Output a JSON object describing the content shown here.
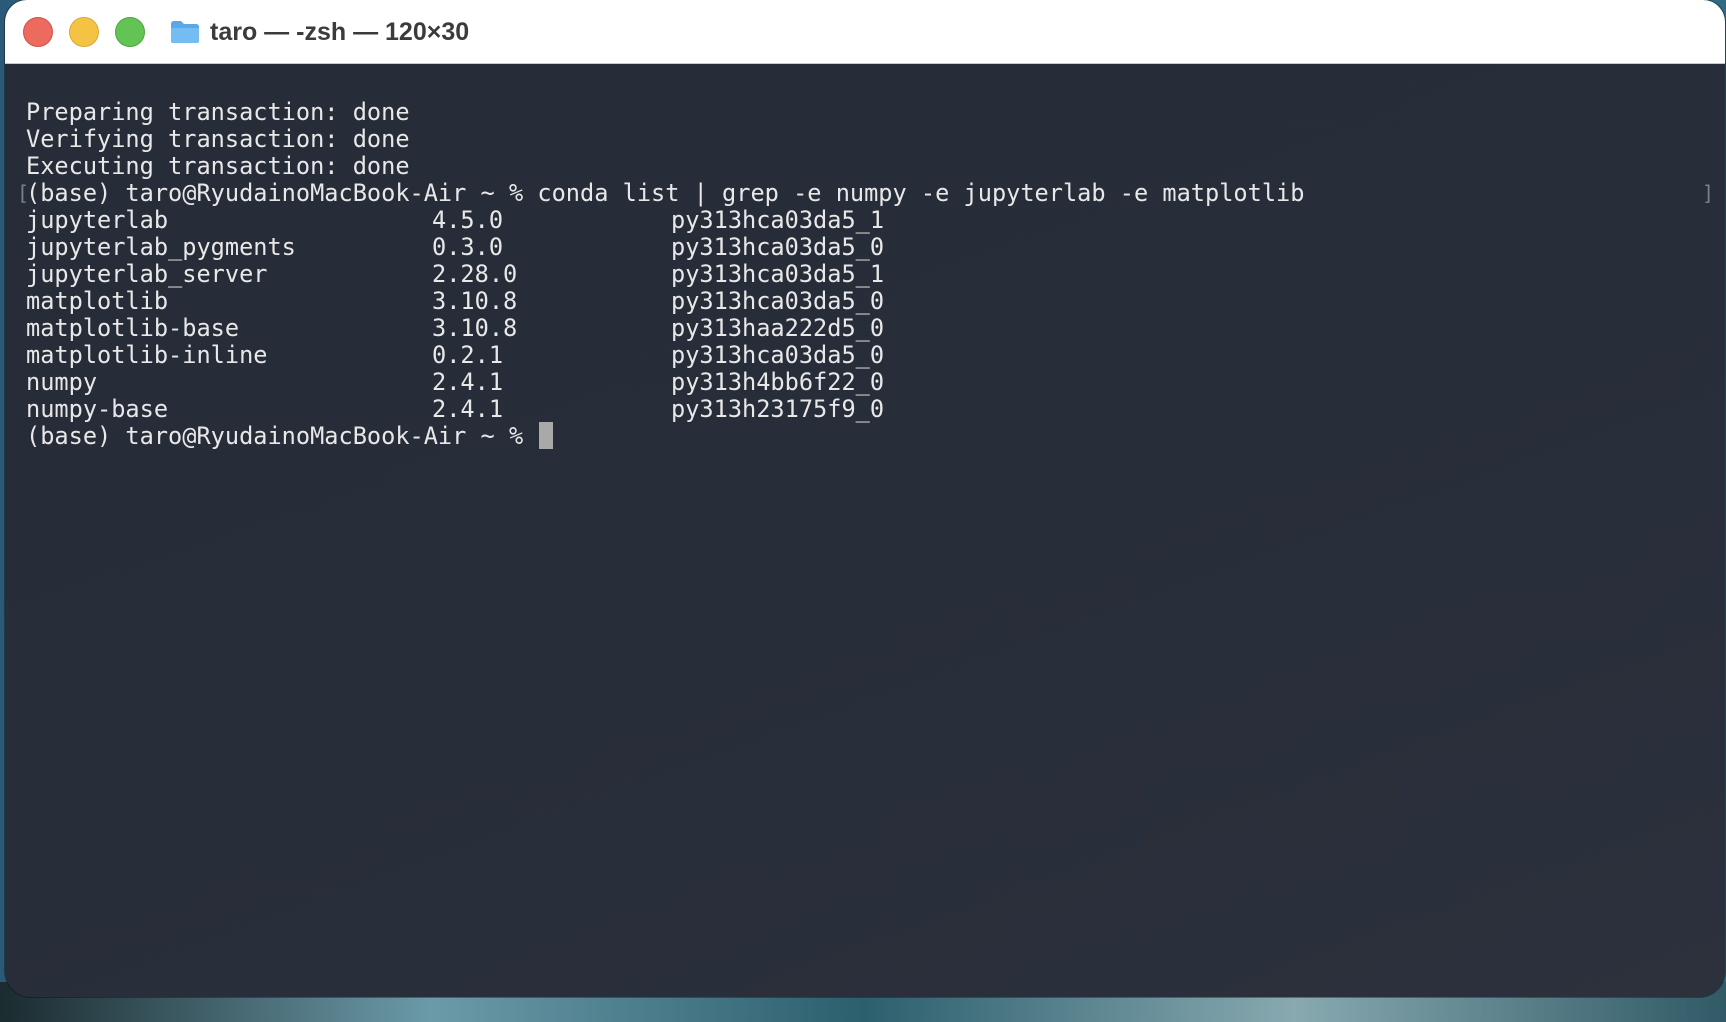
{
  "window": {
    "title": "taro — -zsh — 120×30"
  },
  "terminal": {
    "transaction_lines": [
      "Preparing transaction: done",
      "Verifying transaction: done",
      "Executing transaction: done"
    ],
    "prompt": "(base) taro@RyudainoMacBook-Air ~ %",
    "command": "conda list | grep -e numpy -e jupyterlab -e matplotlib",
    "mark_open": "[",
    "mark_close": "]",
    "packages": [
      {
        "name": "jupyterlab",
        "version": "4.5.0",
        "build": "py313hca03da5_1"
      },
      {
        "name": "jupyterlab_pygments",
        "version": "0.3.0",
        "build": "py313hca03da5_0"
      },
      {
        "name": "jupyterlab_server",
        "version": "2.28.0",
        "build": "py313hca03da5_1"
      },
      {
        "name": "matplotlib",
        "version": "3.10.8",
        "build": "py313hca03da5_0"
      },
      {
        "name": "matplotlib-base",
        "version": "3.10.8",
        "build": "py313haa222d5_0"
      },
      {
        "name": "matplotlib-inline",
        "version": "0.2.1",
        "build": "py313hca03da5_0"
      },
      {
        "name": "numpy",
        "version": "2.4.1",
        "build": "py313h4bb6f22_0"
      },
      {
        "name": "numpy-base",
        "version": "2.4.1",
        "build": "py313h23175f9_0"
      }
    ]
  },
  "colors": {
    "terminal_background": "#262c38",
    "terminal_text": "#e8e8e8",
    "close_button": "#ed6a5e",
    "minimize_button": "#f5c344",
    "maximize_button": "#61c454",
    "cursor": "#a9a9a9"
  }
}
